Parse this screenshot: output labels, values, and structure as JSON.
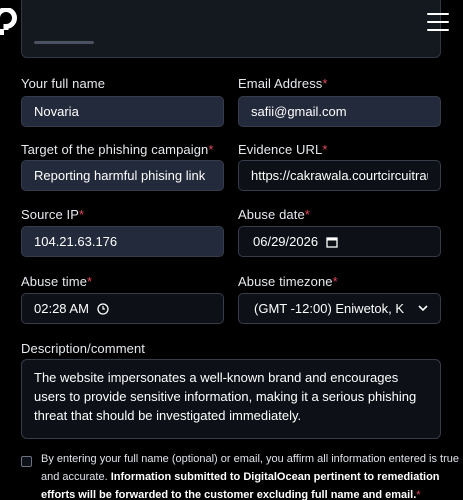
{
  "header": {
    "logo_icon": "digitalocean-logo-icon",
    "menu_icon": "hamburger-menu-icon"
  },
  "form": {
    "full_name": {
      "label": "Your full name",
      "value": "Novaria"
    },
    "email": {
      "label": "Email Address",
      "required": "*",
      "value": "safii@gmail.com"
    },
    "target": {
      "label": "Target of the phishing campaign",
      "required": "*",
      "value": "Reporting harmful phising link"
    },
    "evidence_url": {
      "label": "Evidence URL",
      "required": "*",
      "value": "https://cakrawala.courtcircuitrau"
    },
    "source_ip": {
      "label": "Source IP",
      "required": "*",
      "value": "104.21.63.176"
    },
    "abuse_date": {
      "label": "Abuse date",
      "required": "*",
      "value": "06/29/2026"
    },
    "abuse_time": {
      "label": "Abuse time",
      "required": "*",
      "value": "02:28 AM"
    },
    "abuse_timezone": {
      "label": "Abuse timezone",
      "required": "*",
      "value": "(GMT -12:00) Eniwetok, K"
    },
    "description": {
      "label": "Description/comment",
      "value": "The website impersonates a well-known brand and encourages users to provide sensitive information, making it a serious phishing threat that should be investigated immediately."
    },
    "consent": {
      "text": "By entering your full name (optional) or email, you affirm all information entered is true and accurate.",
      "bold": "Information submitted to DigitalOcean pertinent to remediation efforts will be forwarded to the customer excluding full name and email.",
      "required": "*"
    }
  },
  "colors": {
    "background": "#000000",
    "field_filled": "#232a3b",
    "field_border": "#363c4a",
    "required": "#e04b5a"
  }
}
